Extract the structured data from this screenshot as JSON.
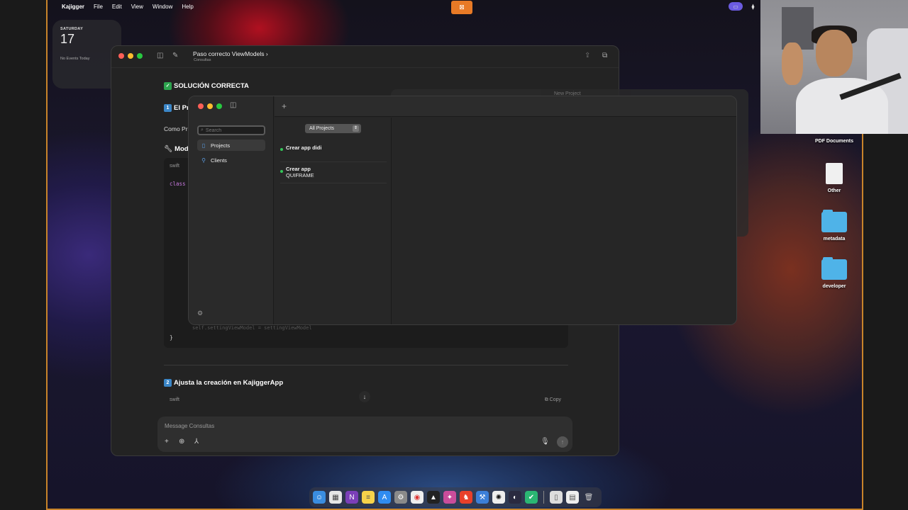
{
  "menubar": {
    "app_name": "Kajigger",
    "items": [
      "File",
      "Edit",
      "View",
      "Window",
      "Help"
    ],
    "keyboard_layout": "US"
  },
  "calendar_widget": {
    "day_of_week": "SATURDAY",
    "day": "17",
    "events": "No Events Today"
  },
  "chat_window": {
    "title": "Paso correcto ViewModels",
    "title_chevron": "›",
    "subtitle": "Consultas",
    "heading_solution": "SOLUCIÓN CORRECTA",
    "step1_prefix": "El Pr",
    "step1_badge": "1",
    "como_text": "Como Pr",
    "modi_text": "Modi",
    "code_lang": "swift",
    "code_keyword": "class",
    "code_ghost_line": "self.settingViewModel = settingViewModel",
    "code_closing": "}",
    "step2_badge": "2",
    "step2_heading": "Ajusta la creación en KajiggerApp",
    "code2_lang": "swift",
    "copy_label": "Copy",
    "composer_placeholder": "Message Consultas"
  },
  "background_window": {
    "title": "New Project"
  },
  "projects_window": {
    "search_placeholder": "Search",
    "sidebar": [
      {
        "label": "Projects",
        "icon": "folder-icon",
        "selected": true
      },
      {
        "label": "Clients",
        "icon": "person-icon",
        "selected": false
      }
    ],
    "filter_selected": "All Projects",
    "projects": [
      {
        "name": "Crear app didi",
        "status_color": "#34c759"
      },
      {
        "name": "Crear app",
        "name_line2": "QUIFRAME",
        "status_color": "#34c759"
      }
    ]
  },
  "desktop_icons": [
    {
      "label": "PDF Documents",
      "kind": "document"
    },
    {
      "label": "Other",
      "kind": "document"
    },
    {
      "label": "metadata",
      "kind": "folder"
    },
    {
      "label": "developer",
      "kind": "folder"
    }
  ],
  "colors": {
    "accent": "#3b86c7",
    "status_green": "#34c759",
    "recording": "#e87a26",
    "frame": "#c8842a"
  }
}
